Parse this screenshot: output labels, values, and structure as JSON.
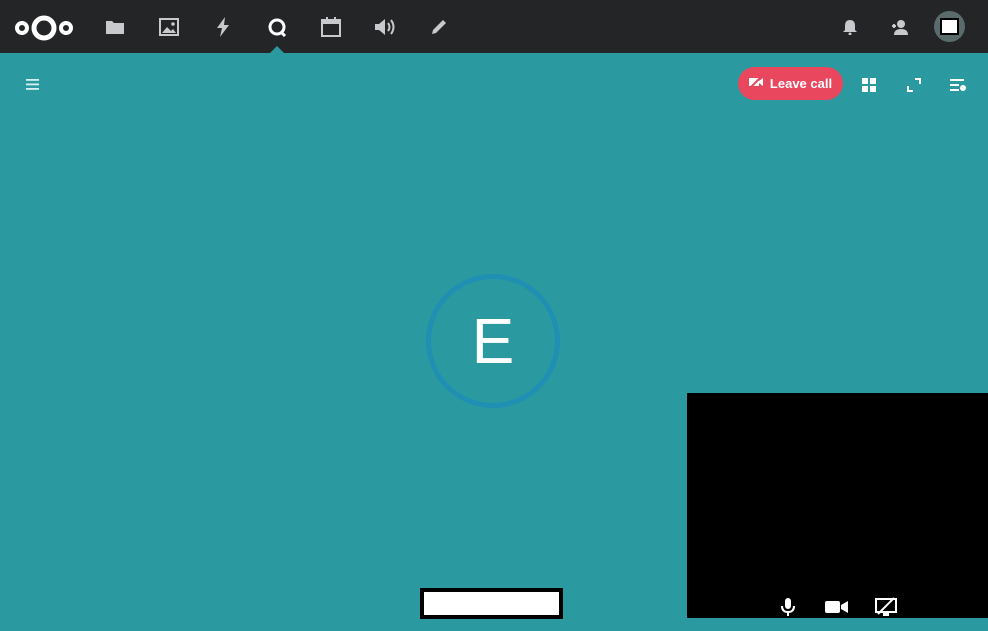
{
  "topbar": {
    "logo": "nextcloud-logo",
    "apps": [
      {
        "name": "files-icon"
      },
      {
        "name": "photos-icon"
      },
      {
        "name": "activity-icon"
      },
      {
        "name": "talk-icon",
        "active": true
      },
      {
        "name": "calendar-icon"
      },
      {
        "name": "announcements-icon"
      },
      {
        "name": "notes-icon"
      }
    ],
    "right": [
      {
        "name": "notifications-bell-icon"
      },
      {
        "name": "contacts-icon"
      }
    ]
  },
  "call": {
    "leave_label": "Leave call",
    "participant_initial": "E",
    "colors": {
      "background": "#2a9aa0",
      "leave_button": "#e9475d",
      "avatar_ring": "#1f8fb3"
    }
  }
}
